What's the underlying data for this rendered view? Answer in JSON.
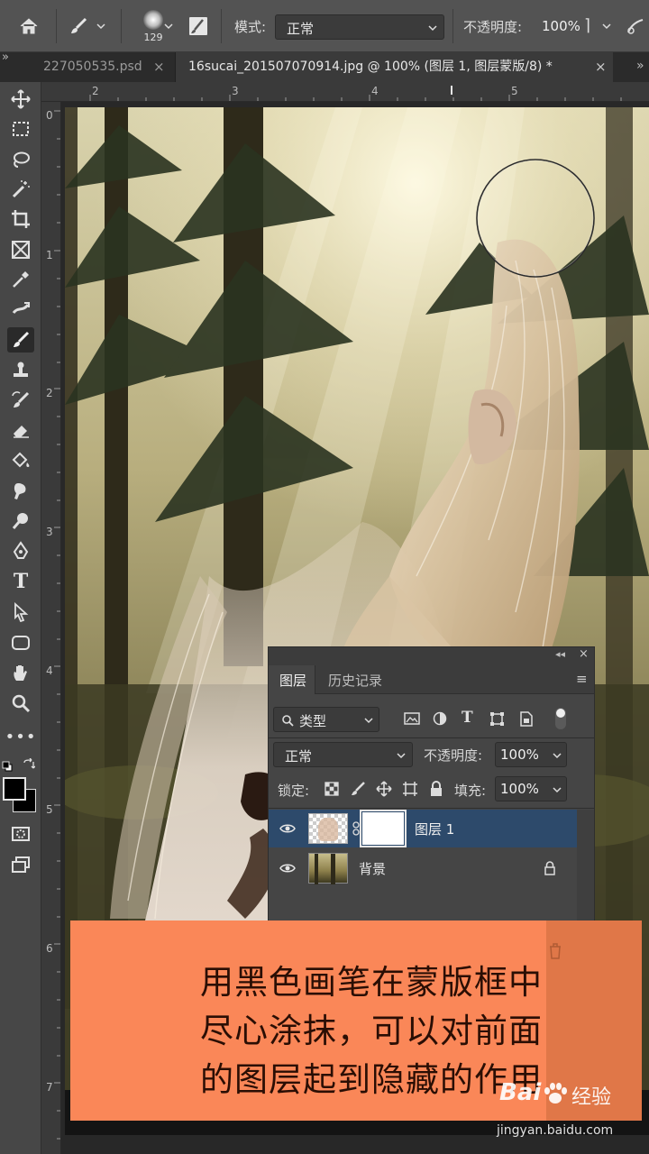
{
  "options_bar": {
    "brush_size": "129",
    "mode_label": "模式:",
    "mode_value": "正常",
    "opacity_label": "不透明度:",
    "opacity_value": "100%"
  },
  "tabs": [
    {
      "label": "227050535.psd",
      "active": false
    },
    {
      "label": "16sucai_201507070914.jpg @ 100% (图层 1, 图层蒙版/8) *",
      "active": true
    }
  ],
  "ruler": {
    "h_numbers": [
      "2",
      "3",
      "4",
      "5"
    ],
    "v_numbers": [
      "0",
      "1",
      "2",
      "3",
      "4",
      "5",
      "6",
      "7"
    ]
  },
  "layers_panel": {
    "tabs": [
      {
        "label": "图层",
        "active": true
      },
      {
        "label": "历史记录",
        "active": false
      }
    ],
    "filter_kind": "类型",
    "blend_mode": "正常",
    "opacity_label": "不透明度:",
    "opacity_value": "100%",
    "lock_label": "锁定:",
    "fill_label": "填充:",
    "fill_value": "100%",
    "layers": [
      {
        "name": "图层 1",
        "selected": true,
        "visible": true,
        "has_mask": true
      },
      {
        "name": "背景",
        "selected": false,
        "visible": true,
        "locked": true
      }
    ]
  },
  "caption": {
    "lines": [
      "用黑色画笔在蒙版框中",
      "尽心涂抹，可以对前面",
      "的图层起到隐藏的作用"
    ]
  },
  "watermark": {
    "brand": "Bai",
    "brand_cn": "经验",
    "url": "jingyan.baidu.com"
  },
  "colors": {
    "ui_bg": "#535353",
    "panel_bg": "#454545",
    "selected_layer": "#2d4a6b",
    "caption_bg": "#fa8758"
  }
}
